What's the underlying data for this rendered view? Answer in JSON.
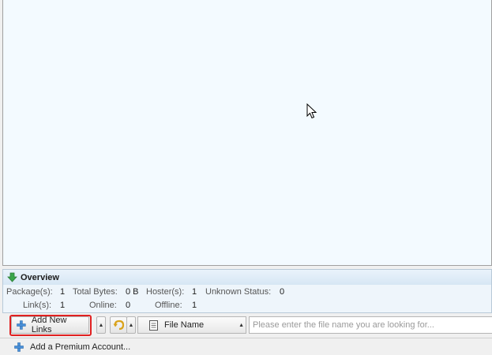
{
  "overview": {
    "title": "Overview",
    "packages_label": "Package(s):",
    "packages_value": "1",
    "total_bytes_label": "Total Bytes:",
    "total_bytes_value": "0 B",
    "hosters_label": "Hoster(s):",
    "hosters_value": "1",
    "unknown_status_label": "Unknown Status:",
    "unknown_status_value": "0",
    "links_label": "Link(s):",
    "links_value": "1",
    "online_label": "Online:",
    "online_value": "0",
    "offline_label": "Offline:",
    "offline_value": "1"
  },
  "toolbar": {
    "add_links_label": "Add New Links",
    "search_field_label": "File Name",
    "search_placeholder": "Please enter the file name you are looking for..."
  },
  "statusbar": {
    "add_premium_label": "Add a Premium Account..."
  },
  "colors": {
    "list_background": "#f3faff",
    "highlight": "#e02020",
    "add_icon": "#4a90d9",
    "overview_icon": "#3aa64a"
  }
}
